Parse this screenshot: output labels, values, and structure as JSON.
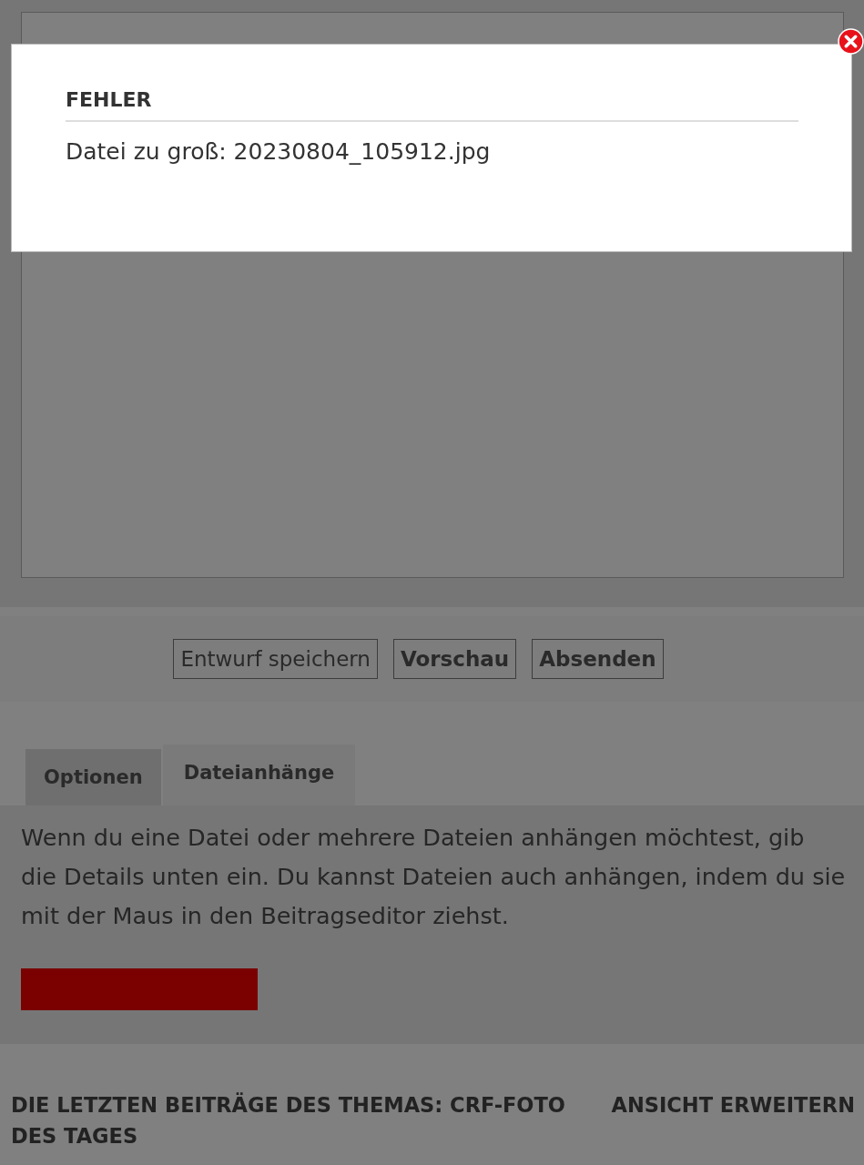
{
  "dialog": {
    "title": "FEHLER",
    "message": "Datei zu groß: 20230804_105912.jpg"
  },
  "buttons": [
    {
      "label": "Entwurf speichern",
      "kind": "plain"
    },
    {
      "label": "Vorschau",
      "kind": "bold"
    },
    {
      "label": "Absenden",
      "kind": "bold"
    }
  ],
  "tabs": [
    {
      "label": "Optionen",
      "selected": false
    },
    {
      "label": "Dateianhänge",
      "selected": true
    }
  ],
  "attachments": {
    "text": "Wenn du eine Datei oder mehrere Dateien anhängen möchtest, gib die Details unten ein. Du kannst Dateien auch anhängen, indem du sie mit der Maus in den Beitragseditor ziehst."
  },
  "recent": {
    "heading": "DIE LETZTEN BEITRÄGE DES THEMAS: CRF-FOTO DES TAGES",
    "link": "ANSICHT ERWEITERN"
  }
}
